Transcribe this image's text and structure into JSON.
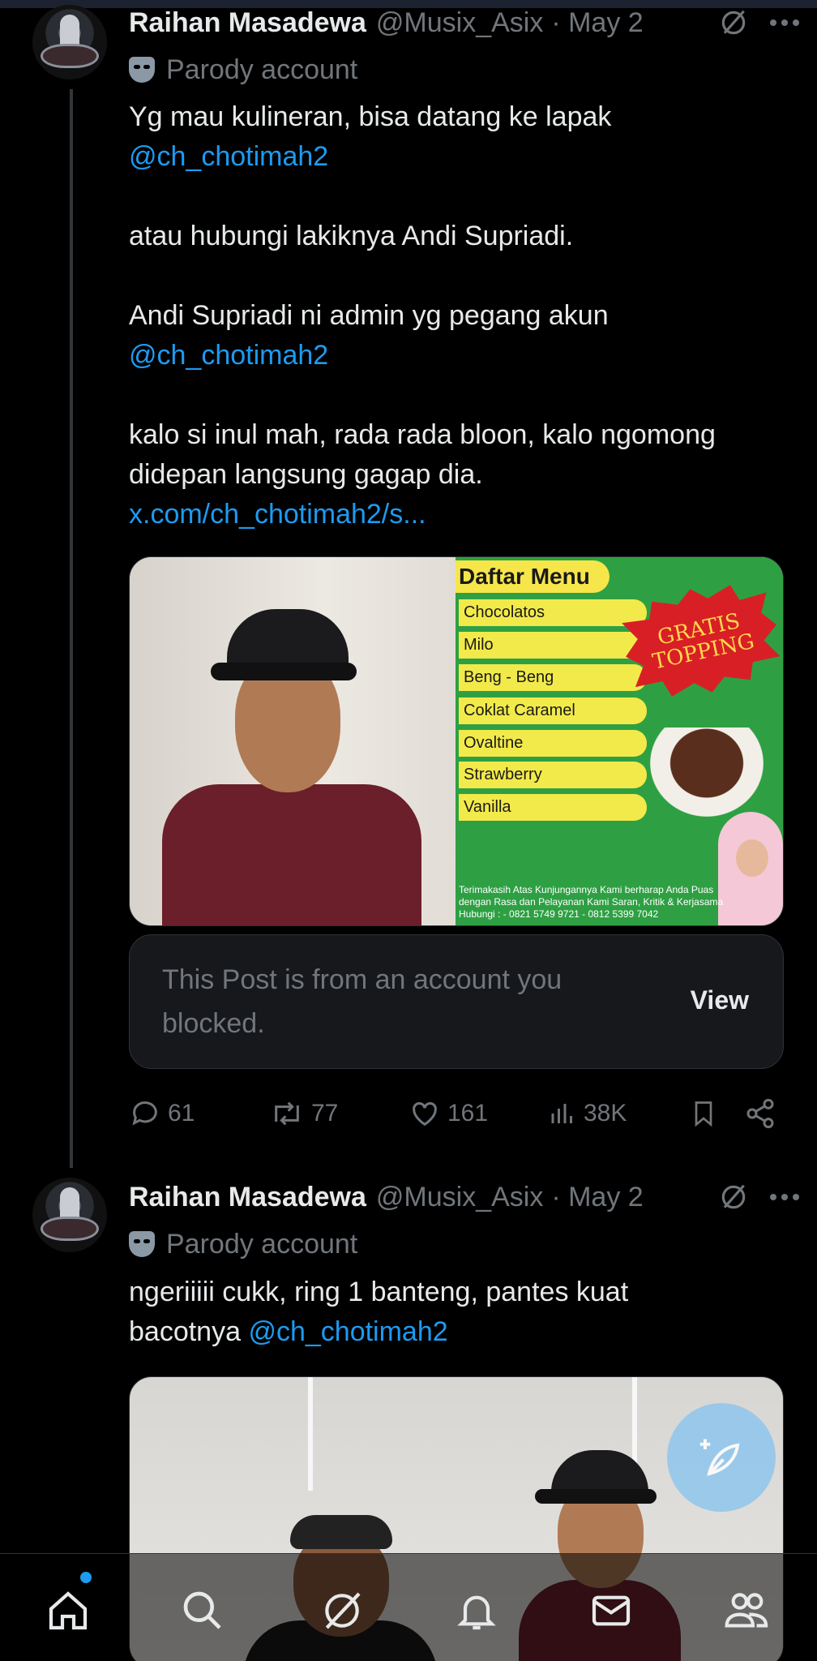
{
  "posts": [
    {
      "author": {
        "name": "Raihan Masadewa",
        "handle": "@Musix_Asix",
        "date": "· May 2"
      },
      "parody_label": "Parody account",
      "text": {
        "l1": "Yg mau kulineran, bisa datang ke lapak",
        "l1_mention": "@ch_chotimah2",
        "l2": "atau hubungi lakiknya Andi Supriadi.",
        "l3": "Andi Supriadi ni admin yg pegang akun",
        "l3_mention": "@ch_chotimah2",
        "l4a": "kalo si inul mah, rada rada bloon, kalo ngomong",
        "l4b": "didepan langsung gagap dia.",
        "link": "x.com/ch_chotimah2/s..."
      },
      "media": {
        "menu_title": "Daftar Menu",
        "menu_items": [
          "Chocolatos",
          "Milo",
          "Beng - Beng",
          "Coklat Caramel",
          "Ovaltine",
          "Strawberry",
          "Vanilla"
        ],
        "badge": "GRATIS TOPPING",
        "note": "Terimakasih Atas Kunjungannya Kami berharap Anda Puas dengan Rasa dan Pelayanan Kami Saran, Kritik & Kerjasama Hubungi : - 0821 5749 9721 - 0812 5399 7042"
      },
      "blocked": {
        "message": "This Post is from an account you blocked.",
        "view_label": "View"
      },
      "stats": {
        "replies": "61",
        "reposts": "77",
        "likes": "161",
        "views": "38K"
      }
    },
    {
      "author": {
        "name": "Raihan Masadewa",
        "handle": "@Musix_Asix",
        "date": "· May 2"
      },
      "parody_label": "Parody account",
      "text": {
        "l1": "ngeriiiii cukk, ring 1 banteng, pantes kuat",
        "l2": "bacotnya",
        "l2_mention": "@ch_chotimah2"
      }
    }
  ],
  "nav": [
    "home-icon",
    "search-icon",
    "grok-icon",
    "notifications-icon",
    "messages-icon",
    "communities-icon"
  ],
  "colors": {
    "link": "#1d9bf0",
    "muted": "#71767b",
    "fab": "#8fc6ee"
  }
}
